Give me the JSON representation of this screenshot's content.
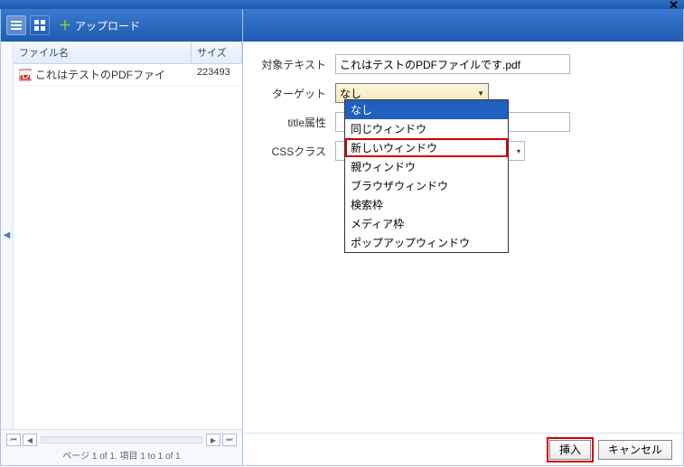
{
  "toolbar": {
    "upload_label": "アップロード"
  },
  "grid": {
    "headers": {
      "name": "ファイル名",
      "size": "サイズ"
    },
    "rows": [
      {
        "name": "これはテストのPDFファイ",
        "size": "223493"
      }
    ]
  },
  "pager": {
    "text": "ページ 1 of 1. 項目 1 to 1 of 1"
  },
  "form": {
    "labels": {
      "target_text": "対象テキスト",
      "target": "ターゲット",
      "title_attr": "title属性",
      "css_class": "CSSクラス"
    },
    "values": {
      "target_text": "これはテストのPDFファイルです.pdf",
      "target": "なし",
      "title_attr": "",
      "css_class": ""
    }
  },
  "dropdown": {
    "items": [
      "なし",
      "同じウィンドウ",
      "新しいウィンドウ",
      "親ウィンドウ",
      "ブラウザウィンドウ",
      "検索枠",
      "メディア枠",
      "ポップアップウィンドウ"
    ]
  },
  "footer": {
    "insert": "挿入",
    "cancel": "キャンセル"
  }
}
